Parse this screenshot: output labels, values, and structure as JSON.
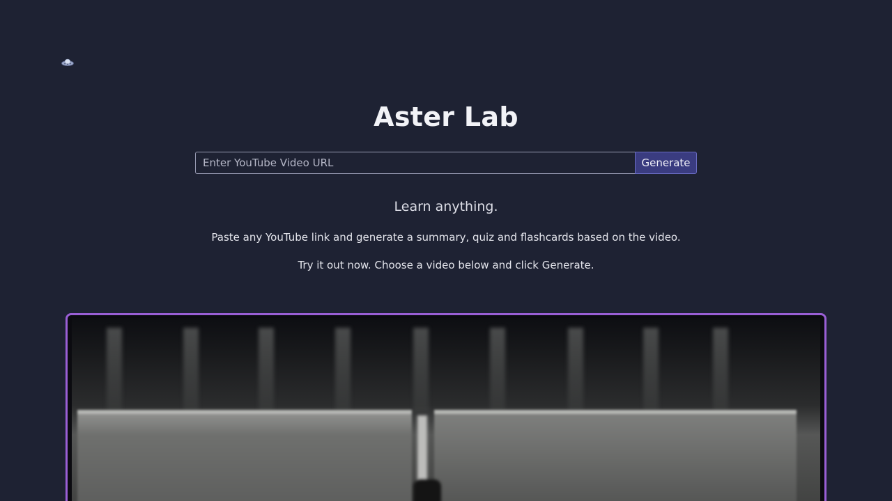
{
  "app": {
    "title": "Aster Lab",
    "logo_icon": "ufo-icon"
  },
  "search": {
    "placeholder": "Enter YouTube Video URL",
    "value": "",
    "button_label": "Generate"
  },
  "hero": {
    "tagline": "Learn anything.",
    "description": "Paste any YouTube link and generate a summary, quiz and flashcards based on the video.",
    "cta": "Try it out now. Choose a video below and click Generate."
  },
  "colors": {
    "background": "#1e2233",
    "accent_border": "#9a5fd6",
    "button_bg": "#3a3c80"
  }
}
